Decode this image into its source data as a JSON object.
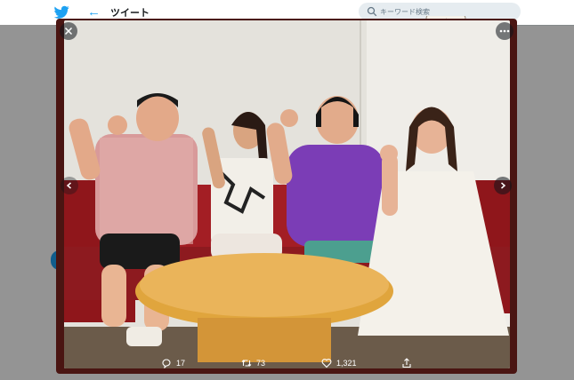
{
  "header": {
    "title": "ツイート",
    "search_placeholder": "キーワード検索"
  },
  "lightbox": {
    "reply_count": "17",
    "retweet_count": "73",
    "like_count": "1,321"
  },
  "colors": {
    "twitter_blue": "#1da1f2",
    "modal_background": "#4a1512"
  },
  "icons": [
    "twitter-bird-icon",
    "back-arrow-icon",
    "search-icon",
    "close-icon",
    "more-icon",
    "chevron-left-icon",
    "chevron-right-icon",
    "reply-icon",
    "retweet-icon",
    "like-icon",
    "share-icon"
  ]
}
